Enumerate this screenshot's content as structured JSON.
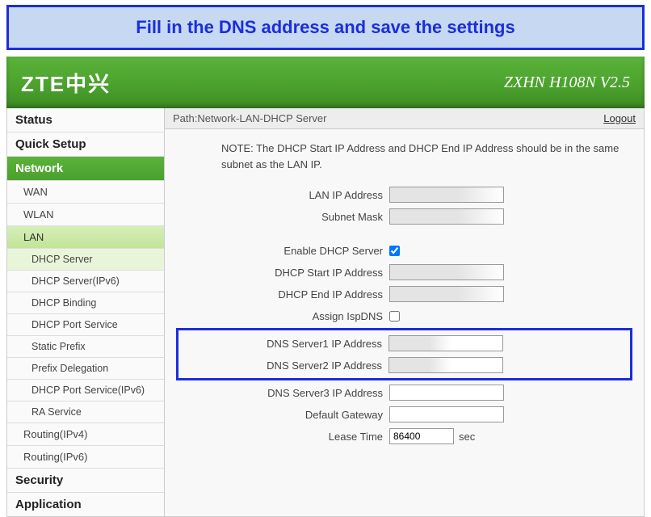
{
  "caption": "Fill in the DNS address and save the settings",
  "header": {
    "brand": "ZTE中兴",
    "model": "ZXHN H108N V2.5"
  },
  "path": {
    "label": "Path:",
    "value": "Network-LAN-DHCP Server",
    "logout": "Logout"
  },
  "note": "NOTE: The DHCP Start IP Address and DHCP End IP Address should be in the same subnet as the LAN IP.",
  "sidebar": {
    "status": "Status",
    "quick_setup": "Quick Setup",
    "network": "Network",
    "wan": "WAN",
    "wlan": "WLAN",
    "lan": "LAN",
    "dhcp_server": "DHCP Server",
    "dhcp_server_ipv6": "DHCP Server(IPv6)",
    "dhcp_binding": "DHCP Binding",
    "dhcp_port_service": "DHCP Port Service",
    "static_prefix": "Static Prefix",
    "prefix_delegation": "Prefix Delegation",
    "dhcp_port_service_ipv6": "DHCP Port Service(IPv6)",
    "ra_service": "RA Service",
    "routing_ipv4": "Routing(IPv4)",
    "routing_ipv6": "Routing(IPv6)",
    "security": "Security",
    "application": "Application"
  },
  "form": {
    "lan_ip_label": "LAN IP Address",
    "lan_ip_value": "",
    "subnet_label": "Subnet Mask",
    "subnet_value": "",
    "enable_dhcp_label": "Enable DHCP Server",
    "enable_dhcp_checked": true,
    "dhcp_start_label": "DHCP Start IP Address",
    "dhcp_start_value": "",
    "dhcp_end_label": "DHCP End IP Address",
    "dhcp_end_value": "",
    "assign_ispdns_label": "Assign IspDNS",
    "assign_ispdns_checked": false,
    "dns1_label": "DNS Server1 IP Address",
    "dns1_value": "",
    "dns2_label": "DNS Server2 IP Address",
    "dns2_value": "",
    "dns3_label": "DNS Server3 IP Address",
    "dns3_value": "",
    "gateway_label": "Default Gateway",
    "gateway_value": "",
    "lease_label": "Lease Time",
    "lease_value": "86400",
    "lease_suffix": "sec"
  }
}
